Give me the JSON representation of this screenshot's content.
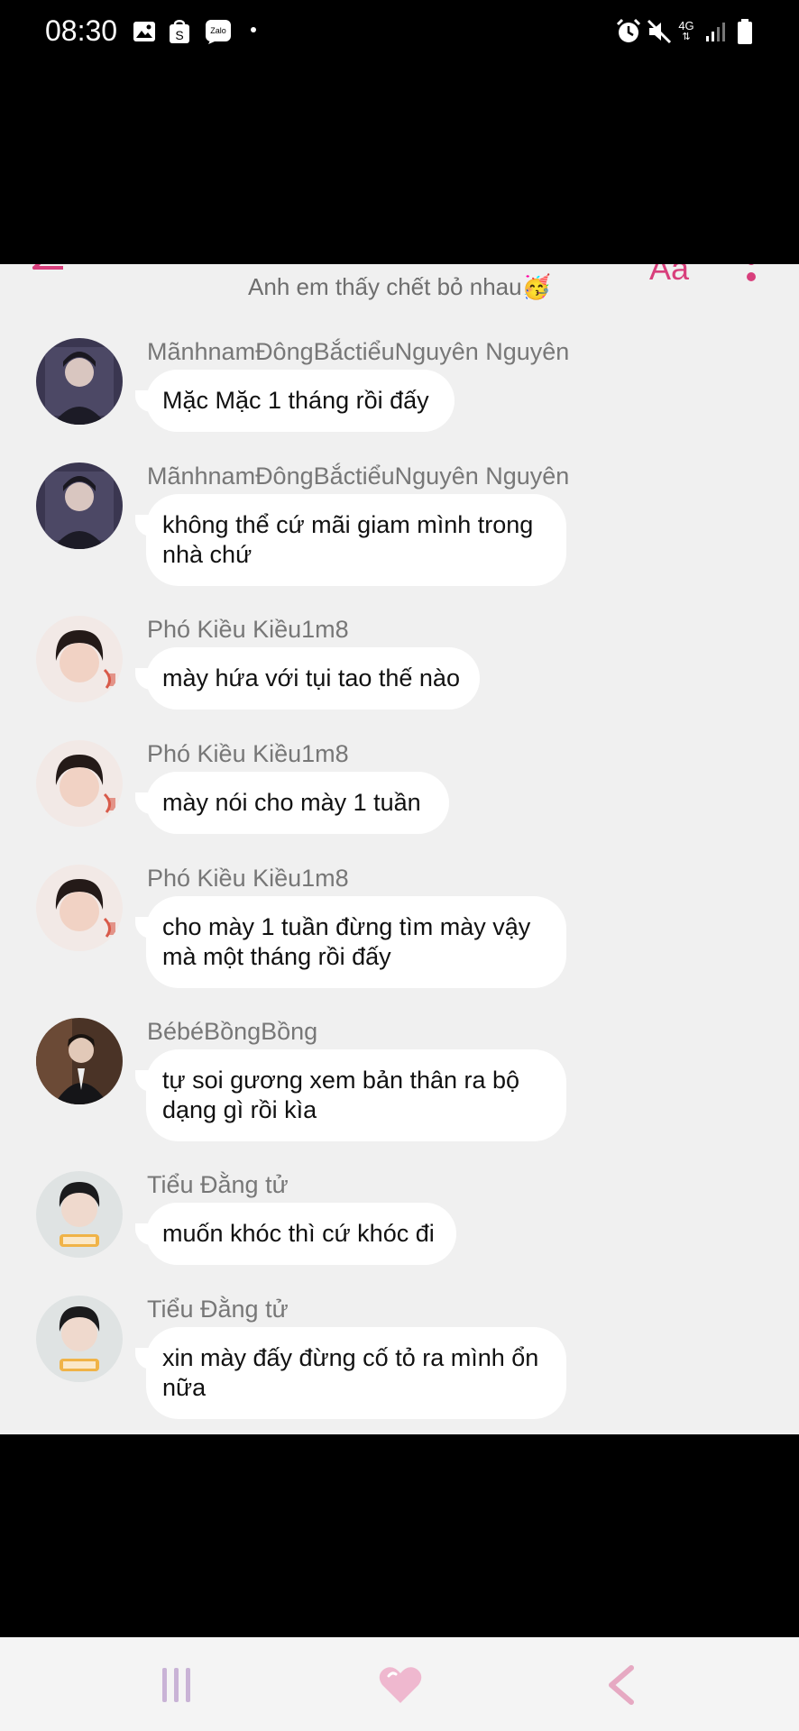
{
  "status_bar": {
    "time": "08:30",
    "network": "4G",
    "icons": [
      "image-icon",
      "shop-icon",
      "zalo-icon",
      "alarm-icon",
      "mute-icon",
      "signal-icon",
      "battery-icon"
    ]
  },
  "chat": {
    "subtitle": "Anh em thấy chết bỏ nhau🥳",
    "font_button": "Aa",
    "messages": [
      {
        "sender": "MãnhnamĐôngBắctiểuNguyên Nguyên",
        "text": "Mặc Mặc 1 tháng rồi đấy"
      },
      {
        "sender": "MãnhnamĐôngBắctiểuNguyên Nguyên",
        "text": "không thể cứ mãi giam mình trong nhà chứ"
      },
      {
        "sender": "Phó Kiều Kiều1m8",
        "text": "mày hứa với tụi tao thế nào"
      },
      {
        "sender": "Phó Kiều Kiều1m8",
        "text": "mày nói cho mày 1 tuần"
      },
      {
        "sender": "Phó Kiều Kiều1m8",
        "text": "cho mày 1 tuần đừng tìm mày vậy mà một tháng rồi đấy"
      },
      {
        "sender": "BébéBồngBồng",
        "text": "tự soi gương xem bản thân ra bộ dạng gì rồi kìa"
      },
      {
        "sender": "Tiểu Đằng tử",
        "text": "muốn khóc thì cứ khóc đi"
      },
      {
        "sender": "Tiểu Đằng tử",
        "text": "xin mày đấy đừng cố tỏ ra mình ổn nữa"
      }
    ]
  },
  "colors": {
    "accent": "#d83f7c",
    "chat_background": "#f0f0f0",
    "bubble": "#ffffff",
    "sender_text": "#777777"
  }
}
